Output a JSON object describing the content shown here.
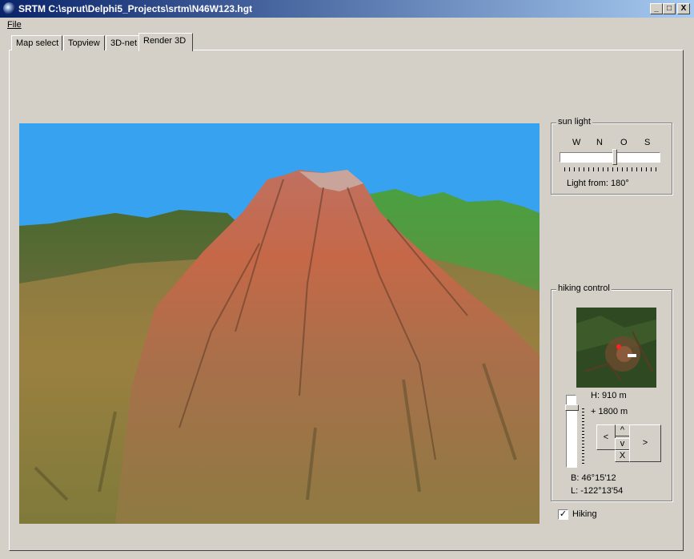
{
  "window": {
    "title": "SRTM C:\\sprut\\Delphi5_Projects\\srtm\\N46W123.hgt",
    "minimize": "_",
    "maximize": "□",
    "close": "X"
  },
  "menu": {
    "file": "File"
  },
  "tabs": [
    {
      "label": "Map select"
    },
    {
      "label": "Topview"
    },
    {
      "label": "3D-net"
    },
    {
      "label": "Render 3D"
    }
  ],
  "sun_light": {
    "title": "sun light",
    "directions": [
      "W",
      "N",
      "O",
      "S"
    ],
    "light_from": "Light from: 180°"
  },
  "hiking": {
    "title": "hiking control",
    "height": "H: 910 m",
    "offset": "+ 1800 m",
    "nav": {
      "up": "^",
      "left": "<",
      "down": "v",
      "right": ">",
      "center": "X"
    },
    "lat": "B: 46°15'12",
    "lon": "L: -122°13'54",
    "checkbox_label": "Hiking",
    "checkbox_checked": "✓"
  },
  "colors": {
    "sky": "#36a2f0",
    "title_gradient_start": "#0a246a",
    "title_gradient_end": "#a6caf0"
  }
}
